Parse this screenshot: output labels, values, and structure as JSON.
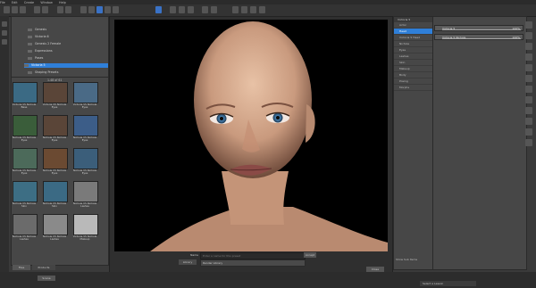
{
  "menu": [
    "File",
    "Edit",
    "Create",
    "Window",
    "Help"
  ],
  "content_tree": {
    "items": [
      "Genesis",
      "Victoria 6",
      "Genesis 2 Female",
      "Expressions",
      "Poses",
      "Victoria 5",
      "Shaping Presets"
    ],
    "selected_index": 5
  },
  "library": {
    "count_label": "1-48 of 61",
    "tiles": [
      {
        "label": "Victoria V5 Nichole Base"
      },
      {
        "label": "Victoria V5 Nichole Eyes"
      },
      {
        "label": "Victoria V5 Nichole Eyes"
      },
      {
        "label": "Nichole V5 Nichole Eyes"
      },
      {
        "label": "Nichole V5 Nichole Eyes"
      },
      {
        "label": "Nichole V5 Nichole Eyes"
      },
      {
        "label": "Nichole V5 Nichole Eyes"
      },
      {
        "label": "Nichole V5 Nichole Eyes"
      },
      {
        "label": "Nichole V5 Nichole Eyes"
      },
      {
        "label": "Nichole V5 Nichole Skin"
      },
      {
        "label": "Nichole V5 Nichole Skin"
      },
      {
        "label": "Nichole V5 Nichole Lashes"
      },
      {
        "label": "Nichole V5 Nichole Lashes"
      },
      {
        "label": "Nichole V5 Nichole Lashes"
      },
      {
        "label": "Victoria V5 Nichole Makeup"
      }
    ],
    "bottom_tabs": [
      "Files",
      "Products"
    ]
  },
  "viewport": {
    "name_label": "Name",
    "name_placeholder": "Enter a name for this preset",
    "category_label": "Library",
    "category_value": "Render Library",
    "accept_label": "Accept",
    "close_label": "Close"
  },
  "parameters_panel": {
    "header": "Victoria 5",
    "list": [
      "Actor",
      "Head",
      "Victoria 5 Head",
      "Nichole",
      "Eyes",
      "Lashes",
      "Skin",
      "Makeup",
      "Body",
      "Posing",
      "Morphs"
    ],
    "selected_index": 1,
    "sliders": [
      {
        "name": "Victoria 5",
        "value": "100%",
        "fraction": 1.0
      },
      {
        "name": "Victoria 5 Nichole",
        "value": "100%",
        "fraction": 1.0
      }
    ],
    "show_sub_items": "Show Sub Items"
  },
  "status": {
    "left": "Scene",
    "right": "Select a Lesson"
  }
}
